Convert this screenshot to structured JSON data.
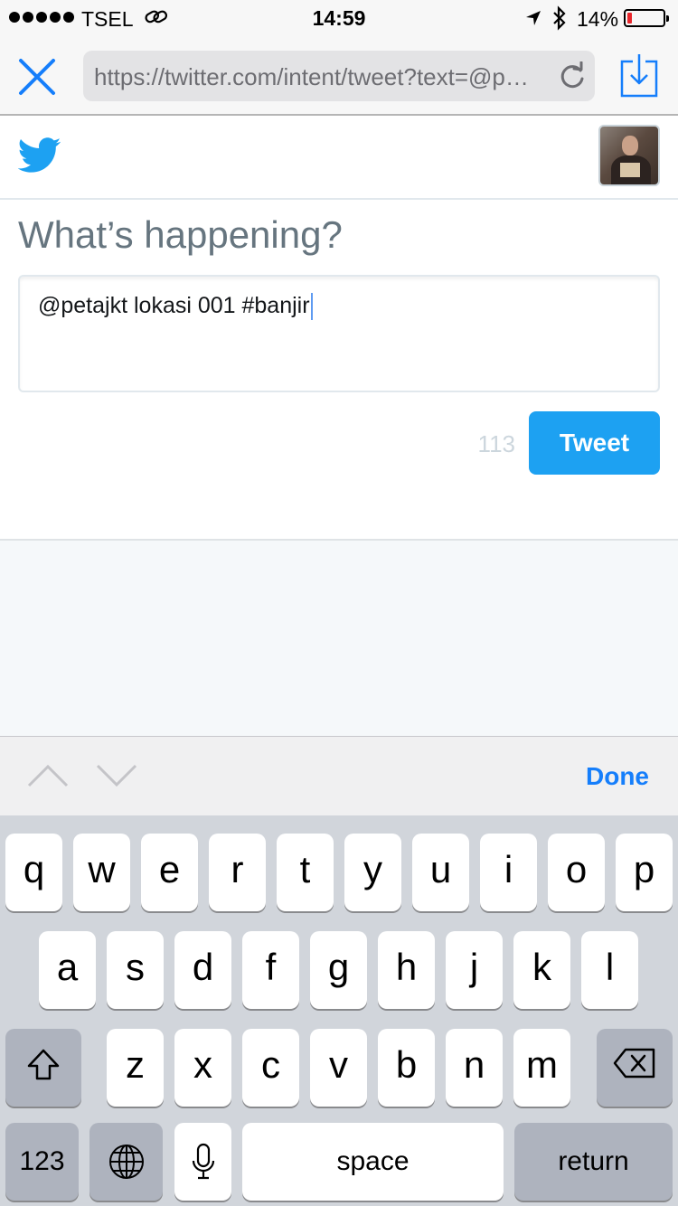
{
  "status_bar": {
    "carrier": "TSEL",
    "time": "14:59",
    "battery_percent": "14%",
    "battery_level": 0.14,
    "battery_color": "#e8262b"
  },
  "browser": {
    "url": "https://twitter.com/intent/tweet?text=@petajkt lokasi 001 #banjir",
    "close_icon": "close-icon",
    "reload_icon": "reload-icon",
    "share_icon": "share-icon"
  },
  "twitter": {
    "logo_icon": "twitter-bird-icon",
    "accent_color": "#1da1f2",
    "compose_heading": "What’s happening?",
    "tweet_text": "@petajkt lokasi 001 #banjir",
    "char_count": "113",
    "tweet_button": "Tweet"
  },
  "accessory_bar": {
    "prev_icon": "chevron-up-icon",
    "next_icon": "chevron-down-icon",
    "done_label": "Done",
    "done_color": "#157efb"
  },
  "keyboard": {
    "row1": [
      "q",
      "w",
      "e",
      "r",
      "t",
      "y",
      "u",
      "i",
      "o",
      "p"
    ],
    "row2": [
      "a",
      "s",
      "d",
      "f",
      "g",
      "h",
      "j",
      "k",
      "l"
    ],
    "row3": [
      "z",
      "x",
      "c",
      "v",
      "b",
      "n",
      "m"
    ],
    "numbers_label": "123",
    "space_label": "space",
    "return_label": "return",
    "shift_icon": "shift-icon",
    "delete_icon": "backspace-icon",
    "globe_icon": "globe-icon",
    "mic_icon": "microphone-icon"
  }
}
